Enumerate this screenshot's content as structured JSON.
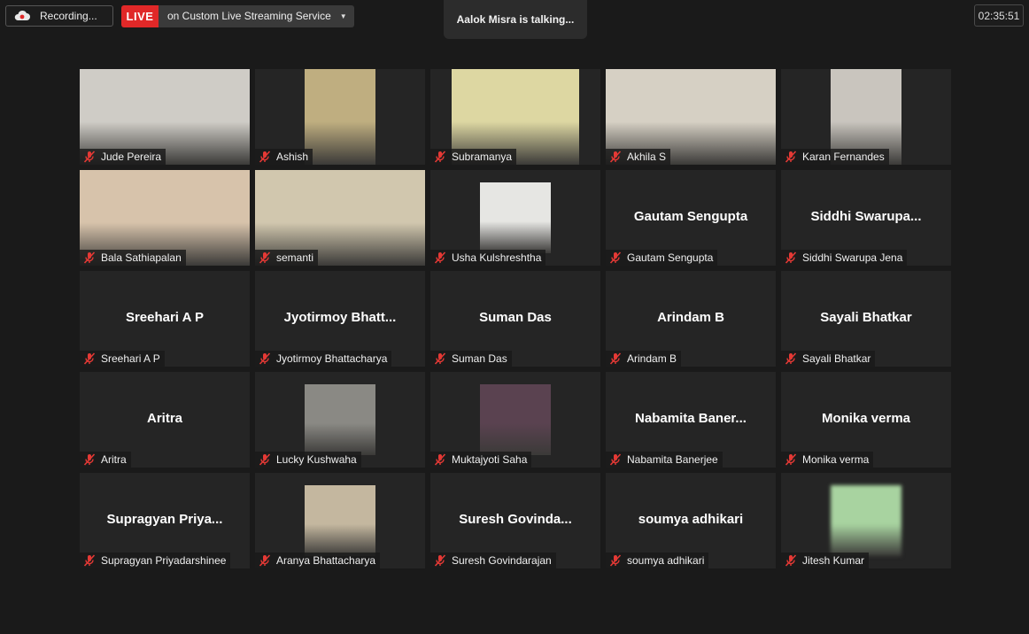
{
  "toolbar": {
    "recording_label": "Recording...",
    "live_badge": "LIVE",
    "live_service": "on Custom Live Streaming Service",
    "talking": "Aalok Misra is talking...",
    "timer": "02:35:51"
  },
  "participants": [
    {
      "name": "Jude Pereira",
      "display": "",
      "video": "full",
      "bg": "#cfccc6"
    },
    {
      "name": "Ashish",
      "display": "",
      "video": "center",
      "bg": "#bfae80"
    },
    {
      "name": "Subramanya",
      "display": "",
      "video": "center w144",
      "bg": "#ddd7a2"
    },
    {
      "name": "Akhila S",
      "display": "",
      "video": "full",
      "bg": "#d6d0c4"
    },
    {
      "name": "Karan Fernandes",
      "display": "",
      "video": "center",
      "bg": "#c9c5be"
    },
    {
      "name": "Bala Sathiapalan",
      "display": "",
      "video": "full",
      "bg": "#d7c3ab"
    },
    {
      "name": "semanti",
      "display": "",
      "video": "full",
      "bg": "#d1c7ae"
    },
    {
      "name": "Usha Kulshreshtha",
      "display": "",
      "video": "center w80",
      "bg": "#e6e6e3"
    },
    {
      "name": "Gautam Sengupta",
      "display": "Gautam Sengupta",
      "video": "none",
      "bg": ""
    },
    {
      "name": "Siddhi Swarupa Jena",
      "display": "Siddhi  Swarupa...",
      "video": "none",
      "bg": ""
    },
    {
      "name": "Sreehari A P",
      "display": "Sreehari A P",
      "video": "none",
      "bg": ""
    },
    {
      "name": "Jyotirmoy Bhattacharya",
      "display": "Jyotirmoy  Bhatt...",
      "video": "none",
      "bg": ""
    },
    {
      "name": "Suman Das",
      "display": "Suman Das",
      "video": "none",
      "bg": ""
    },
    {
      "name": "Arindam B",
      "display": "Arindam B",
      "video": "none",
      "bg": ""
    },
    {
      "name": "Sayali Bhatkar",
      "display": "Sayali Bhatkar",
      "video": "none",
      "bg": ""
    },
    {
      "name": "Aritra",
      "display": "Aritra",
      "video": "none",
      "bg": ""
    },
    {
      "name": "Lucky Kushwaha",
      "display": "",
      "video": "center w80",
      "bg": "#8a8984"
    },
    {
      "name": "Muktajyoti Saha",
      "display": "",
      "video": "center w80",
      "bg": "#5a4250"
    },
    {
      "name": "Nabamita Banerjee",
      "display": "Nabamita  Baner...",
      "video": "none",
      "bg": ""
    },
    {
      "name": "Monika verma",
      "display": "Monika verma",
      "video": "none",
      "bg": ""
    },
    {
      "name": "Supragyan Priyadarshinee",
      "display": "Supragyan  Priya...",
      "video": "none",
      "bg": ""
    },
    {
      "name": "Aranya Bhattacharya",
      "display": "",
      "video": "center w80",
      "bg": "#c4b79f"
    },
    {
      "name": "Suresh Govindarajan",
      "display": "Suresh  Govinda...",
      "video": "none",
      "bg": ""
    },
    {
      "name": "soumya adhikari",
      "display": "soumya adhikari",
      "video": "none",
      "bg": ""
    },
    {
      "name": "Jitesh Kumar",
      "display": "",
      "video": "blur",
      "bg": "#a8d3a0"
    }
  ],
  "colors": {
    "background": "#1a1a1a",
    "tile": "#252525",
    "live_red": "#e02828",
    "mute_red": "#e53935"
  },
  "icons": {
    "recording": "cloud-recording-icon",
    "muted": "mic-muted-icon",
    "dropdown": "chevron-down-icon"
  }
}
